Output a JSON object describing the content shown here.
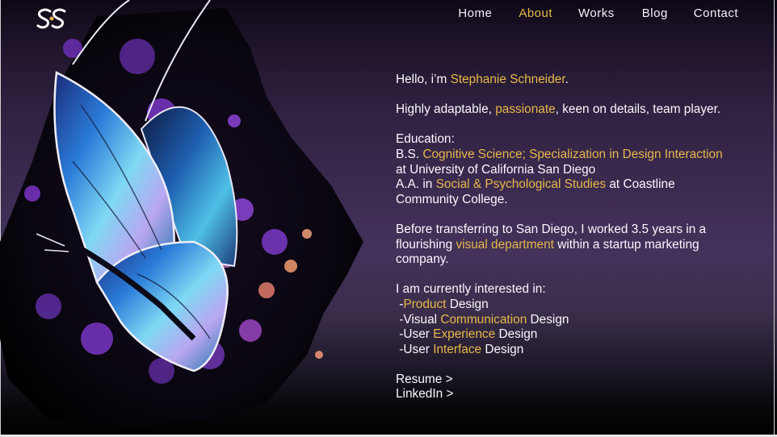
{
  "brand": {
    "logo_text": "SS"
  },
  "nav": {
    "items": [
      {
        "label": "Home",
        "active": false
      },
      {
        "label": "About",
        "active": true
      },
      {
        "label": "Works",
        "active": false
      },
      {
        "label": "Blog",
        "active": false
      },
      {
        "label": "Contact",
        "active": false
      }
    ]
  },
  "about": {
    "greeting_prefix": "Hello, i’m ",
    "name": "Stephanie Schneider",
    "greeting_suffix": ".",
    "intro_a": "Highly adaptable, ",
    "intro_hl": "passionate",
    "intro_b": ", keen on details, team player.",
    "education_heading": "Education:",
    "bs_prefix": "B.S. ",
    "bs_field": "Cognitive Science; Specialization in Design Interaction",
    "bs_suffix": " at University of California San Diego",
    "aa_prefix": "A.A. in ",
    "aa_field": "Social & Psychological Studies",
    "aa_suffix": " at Coastline Community College.",
    "transfer_a": "Before transferring to San Diego, I worked 3.5 years in a flourishing ",
    "transfer_hl": "visual department",
    "transfer_b": " within a startup marketing company.",
    "interests_heading": "I am currently interested in:",
    "interests": [
      {
        "prefix": " -",
        "hl": "Product",
        "suffix": " Design"
      },
      {
        "prefix": " -Visual ",
        "hl": "Communication",
        "suffix": " Design"
      },
      {
        "prefix": " -User ",
        "hl": "Experience",
        "suffix": " Design"
      },
      {
        "prefix": " -User ",
        "hl": "Interface",
        "suffix": " Design"
      }
    ],
    "resume_link": "Resume >",
    "linkedin_link": "LinkedIn >"
  },
  "colors": {
    "accent": "#e7b84a",
    "text": "#fbf7ff",
    "background": "#3d2c52"
  }
}
